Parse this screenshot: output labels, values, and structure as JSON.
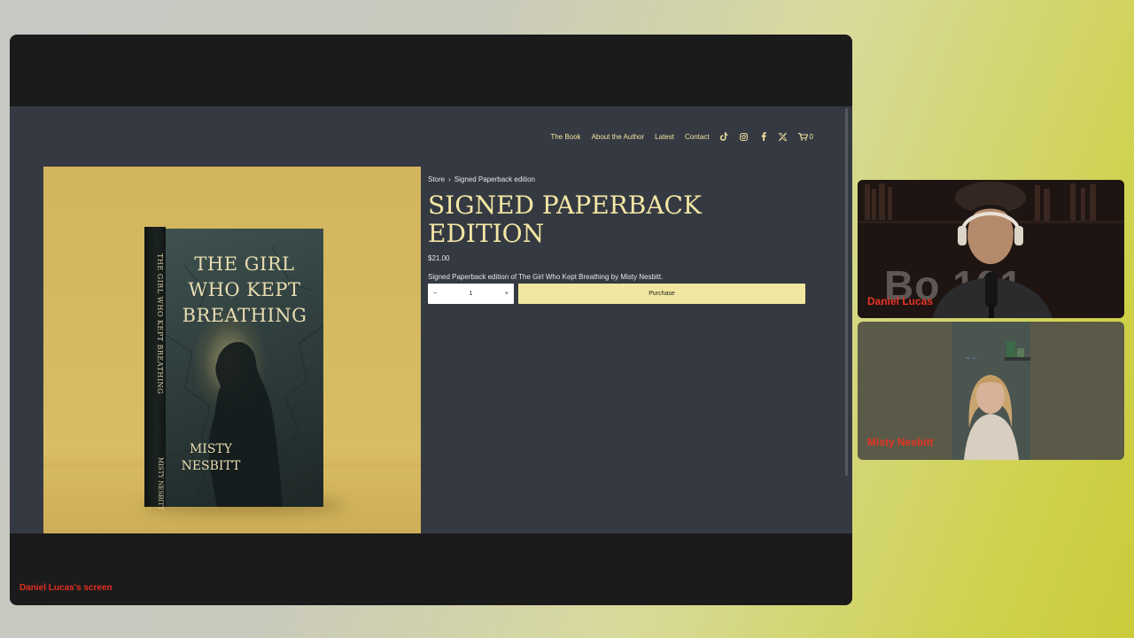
{
  "nav": {
    "items": [
      "The Book",
      "About the Author",
      "Latest",
      "Contact"
    ],
    "icons": [
      "tiktok-icon",
      "instagram-icon",
      "facebook-icon",
      "x-icon",
      "cart-icon"
    ],
    "cart_count": "0"
  },
  "breadcrumb": {
    "store": "Store",
    "separator": "›",
    "current": "Signed Paperback edition"
  },
  "product": {
    "title": "SIGNED PAPERBACK EDITION",
    "price": "$21.00",
    "description": "Signed Paperback edition of The Girl Who Kept Breathing by Misty Nesbitt.",
    "quantity": "1",
    "minus": "−",
    "plus": "+",
    "purchase_label": "Purchase"
  },
  "book_cover": {
    "title": "THE GIRL WHO KEPT BREATHING",
    "author": "MISTY NESBITT",
    "spine_title": "THE GIRL WHO KEPT BREATHING",
    "spine_author": "MISTY NESBITT"
  },
  "screen_label": "Daniel Lucas's screen",
  "participants": [
    {
      "name": "Daniel Lucas",
      "background_text": "Bo   101"
    },
    {
      "name": "Misty Nesbitt"
    }
  ],
  "colors": {
    "accent": "#f2e7a0",
    "site_bg": "#353942",
    "name_label": "#e63224"
  }
}
